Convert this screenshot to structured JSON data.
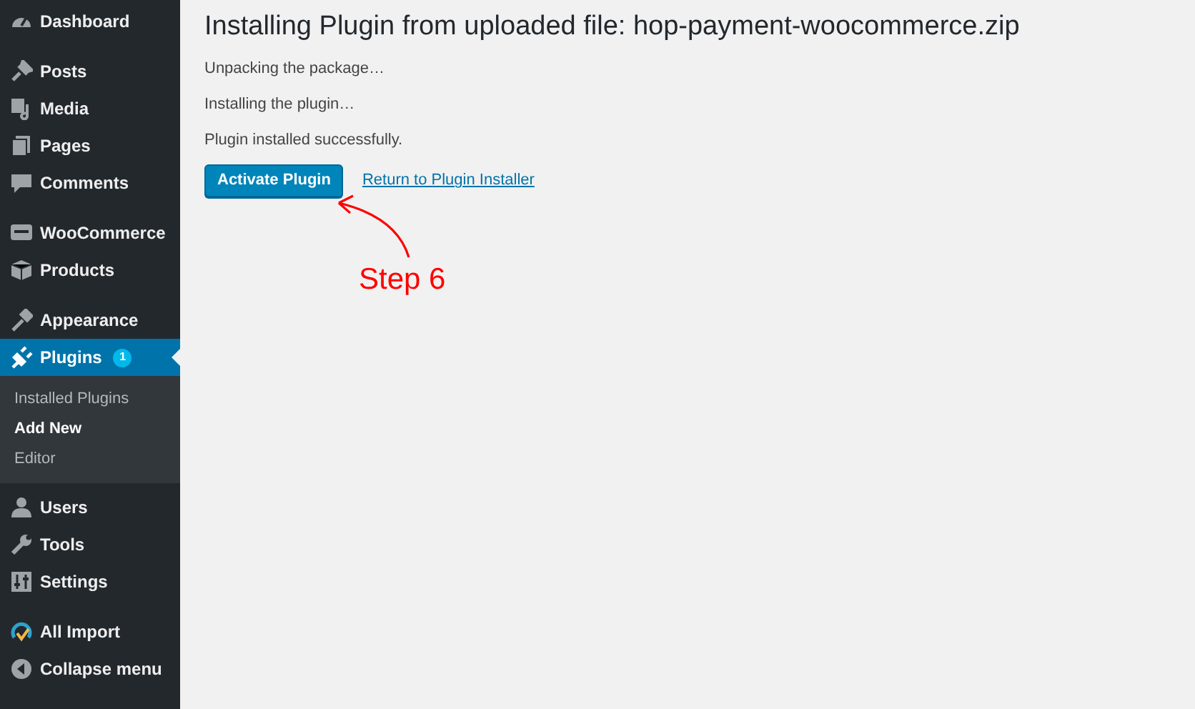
{
  "sidebar": {
    "groups": [
      {
        "items": [
          {
            "label": "Dashboard",
            "selected": false
          }
        ]
      },
      {
        "items": [
          {
            "label": "Posts",
            "selected": false
          },
          {
            "label": "Media",
            "selected": false
          },
          {
            "label": "Pages",
            "selected": false
          },
          {
            "label": "Comments",
            "selected": false
          }
        ]
      },
      {
        "items": [
          {
            "label": "WooCommerce",
            "selected": false
          },
          {
            "label": "Products",
            "selected": false
          }
        ]
      },
      {
        "items": [
          {
            "label": "Appearance",
            "selected": false
          },
          {
            "label": "Plugins",
            "selected": true,
            "badge": "1",
            "submenu": [
              {
                "label": "Installed Plugins",
                "selected": false
              },
              {
                "label": "Add New",
                "selected": true
              },
              {
                "label": "Editor",
                "selected": false
              }
            ]
          },
          {
            "label": "Users",
            "selected": false
          },
          {
            "label": "Tools",
            "selected": false
          },
          {
            "label": "Settings",
            "selected": false
          }
        ]
      },
      {
        "items": [
          {
            "label": "All Import",
            "selected": false
          },
          {
            "label": "Collapse menu",
            "selected": false
          }
        ]
      }
    ]
  },
  "main": {
    "title": "Installing Plugin from uploaded file: hop-payment-woocommerce.zip",
    "messages": [
      "Unpacking the package…",
      "Installing the plugin…",
      "Plugin installed successfully."
    ],
    "primary_button": "Activate Plugin",
    "link": "Return to Plugin Installer"
  },
  "annotation": {
    "text": "Step 6"
  }
}
